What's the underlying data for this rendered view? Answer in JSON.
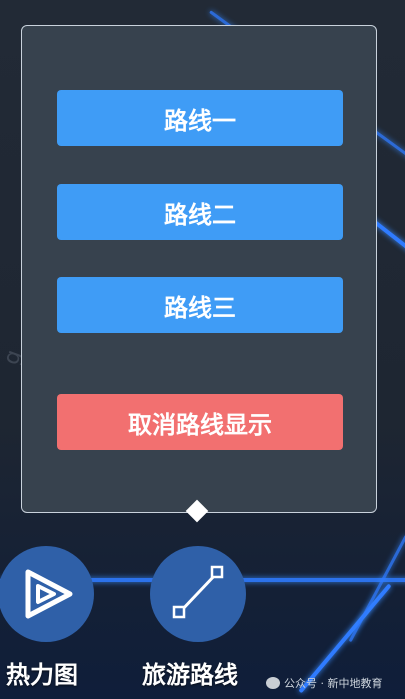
{
  "routes_panel": {
    "route1_label": "路线一",
    "route2_label": "路线二",
    "route3_label": "路线三",
    "cancel_label": "取消路线显示"
  },
  "toolbar": {
    "heatmap_label": "热力图",
    "tour_route_label": "旅游路线"
  },
  "watermark": {
    "text": "公众号 · 新中地教育"
  },
  "colors": {
    "primary_button": "#3f9cf6",
    "danger_button": "#f27070",
    "panel_bg": "#37424e",
    "tool_circle": "#2f60a8"
  },
  "icons": {
    "heatmap": "play-triangle-icon",
    "tour_route": "route-line-icon"
  }
}
